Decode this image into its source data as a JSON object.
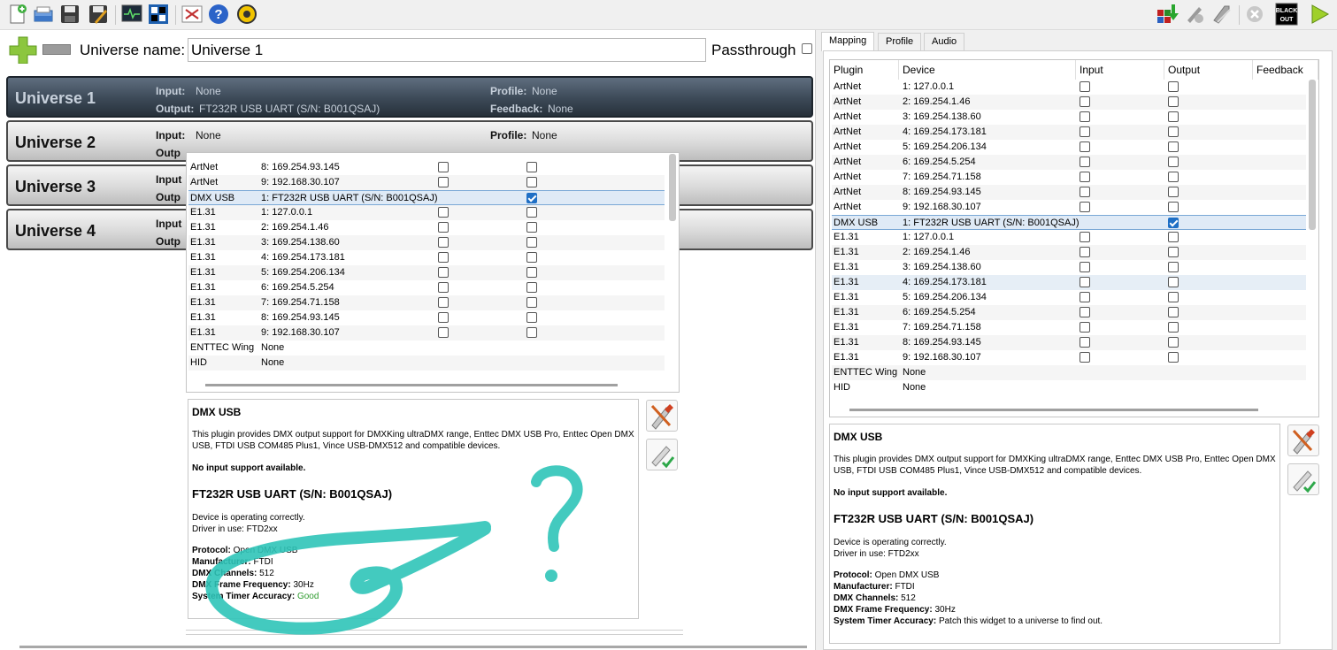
{
  "toolbar": {
    "icons": [
      "new-file-icon",
      "open-file-icon",
      "save-icon",
      "save-as-icon",
      "monitor-icon",
      "fixture-icon",
      "close-icon",
      "help-icon",
      "zoom-icon"
    ],
    "right_icons": [
      "flash-icon",
      "disable-icon",
      "tools-icon",
      "stop-icon",
      "blackout-icon",
      "play-icon"
    ],
    "blackout_label": "BLACK OUT"
  },
  "universe": {
    "name_label": "Universe name:",
    "name_value": "Universe 1",
    "passthrough_label": "Passthrough"
  },
  "universes": [
    {
      "title": "Universe 1",
      "input_label": "Input:",
      "input": "None",
      "output_label": "Output:",
      "output": "FT232R USB UART (S/N: B001QSAJ)",
      "profile_label": "Profile:",
      "profile": "None",
      "feedback_label": "Feedback:",
      "feedback": "None"
    },
    {
      "title": "Universe 2",
      "input_label": "Input:",
      "input": "None",
      "output_label": "Outp",
      "profile_label": "Profile:",
      "profile": "None"
    },
    {
      "title": "Universe 3",
      "input_label": "Input",
      "output_label": "Outp"
    },
    {
      "title": "Universe 4",
      "input_label": "Input",
      "output_label": "Outp"
    }
  ],
  "popup_rows": [
    {
      "plugin": "ArtNet",
      "device": "8: 169.254.93.145",
      "input": false,
      "output": false
    },
    {
      "plugin": "ArtNet",
      "device": "9: 192.168.30.107",
      "input": false,
      "output": false
    },
    {
      "plugin": "DMX USB",
      "device": "1: FT232R USB UART (S/N: B001QSAJ)",
      "output": true,
      "selected": true
    },
    {
      "plugin": "E1.31",
      "device": "1: 127.0.0.1",
      "input": false,
      "output": false
    },
    {
      "plugin": "E1.31",
      "device": "2: 169.254.1.46",
      "input": false,
      "output": false
    },
    {
      "plugin": "E1.31",
      "device": "3: 169.254.138.60",
      "input": false,
      "output": false
    },
    {
      "plugin": "E1.31",
      "device": "4: 169.254.173.181",
      "input": false,
      "output": false
    },
    {
      "plugin": "E1.31",
      "device": "5: 169.254.206.134",
      "input": false,
      "output": false
    },
    {
      "plugin": "E1.31",
      "device": "6: 169.254.5.254",
      "input": false,
      "output": false
    },
    {
      "plugin": "E1.31",
      "device": "7: 169.254.71.158",
      "input": false,
      "output": false
    },
    {
      "plugin": "E1.31",
      "device": "8: 169.254.93.145",
      "input": false,
      "output": false
    },
    {
      "plugin": "E1.31",
      "device": "9: 192.168.30.107",
      "input": false,
      "output": false
    },
    {
      "plugin": "ENTTEC Wing",
      "device": "None"
    },
    {
      "plugin": "HID",
      "device": "None"
    }
  ],
  "plugin_info_left": {
    "title": "DMX USB",
    "desc": "This plugin provides DMX output support for DMXKing ultraDMX range, Enttec DMX USB Pro, Enttec Open DMX USB, FTDI USB COM485 Plus1, Vince USB-DMX512 and compatible devices.",
    "no_input": "No input support available.",
    "device": "FT232R USB UART (S/N: B001QSAJ)",
    "status": "Device is operating correctly.",
    "driver": "Driver in use: FTD2xx",
    "protocol_k": "Protocol:",
    "protocol_v": "Open DMX USB",
    "manufacturer_k": "Manufacturer:",
    "manufacturer_v": "FTDI",
    "channels_k": "DMX Channels:",
    "channels_v": "512",
    "freq_k": "DMX Frame Frequency:",
    "freq_v": "30Hz",
    "timer_k": "System Timer Accuracy:",
    "timer_v": "Good"
  },
  "tabs": [
    "Mapping",
    "Profile",
    "Audio"
  ],
  "right_table": {
    "headers": [
      "Plugin",
      "Device",
      "Input",
      "Output",
      "Feedback"
    ],
    "rows": [
      {
        "plugin": "ArtNet",
        "device": "1: 127.0.0.1",
        "input": false,
        "output": false
      },
      {
        "plugin": "ArtNet",
        "device": "2: 169.254.1.46",
        "input": false,
        "output": false
      },
      {
        "plugin": "ArtNet",
        "device": "3: 169.254.138.60",
        "input": false,
        "output": false
      },
      {
        "plugin": "ArtNet",
        "device": "4: 169.254.173.181",
        "input": false,
        "output": false
      },
      {
        "plugin": "ArtNet",
        "device": "5: 169.254.206.134",
        "input": false,
        "output": false
      },
      {
        "plugin": "ArtNet",
        "device": "6: 169.254.5.254",
        "input": false,
        "output": false
      },
      {
        "plugin": "ArtNet",
        "device": "7: 169.254.71.158",
        "input": false,
        "output": false
      },
      {
        "plugin": "ArtNet",
        "device": "8: 169.254.93.145",
        "input": false,
        "output": false
      },
      {
        "plugin": "ArtNet",
        "device": "9: 192.168.30.107",
        "input": false,
        "output": false
      },
      {
        "plugin": "DMX USB",
        "device": "1: FT232R USB UART (S/N: B001QSAJ)",
        "output": true,
        "selected": true
      },
      {
        "plugin": "E1.31",
        "device": "1: 127.0.0.1",
        "input": false,
        "output": false
      },
      {
        "plugin": "E1.31",
        "device": "2: 169.254.1.46",
        "input": false,
        "output": false
      },
      {
        "plugin": "E1.31",
        "device": "3: 169.254.138.60",
        "input": false,
        "output": false
      },
      {
        "plugin": "E1.31",
        "device": "4: 169.254.173.181",
        "input": false,
        "output": false,
        "hover": true
      },
      {
        "plugin": "E1.31",
        "device": "5: 169.254.206.134",
        "input": false,
        "output": false
      },
      {
        "plugin": "E1.31",
        "device": "6: 169.254.5.254",
        "input": false,
        "output": false
      },
      {
        "plugin": "E1.31",
        "device": "7: 169.254.71.158",
        "input": false,
        "output": false
      },
      {
        "plugin": "E1.31",
        "device": "8: 169.254.93.145",
        "input": false,
        "output": false
      },
      {
        "plugin": "E1.31",
        "device": "9: 192.168.30.107",
        "input": false,
        "output": false
      },
      {
        "plugin": "ENTTEC Wing",
        "device": "None"
      },
      {
        "plugin": "HID",
        "device": "None"
      }
    ]
  },
  "plugin_info_right": {
    "title": "DMX USB",
    "desc": "This plugin provides DMX output support for DMXKing ultraDMX range, Enttec DMX USB Pro, Enttec Open DMX USB, FTDI USB COM485 Plus1, Vince USB-DMX512 and compatible devices.",
    "no_input": "No input support available.",
    "device": "FT232R USB UART (S/N: B001QSAJ)",
    "status": "Device is operating correctly.",
    "driver": "Driver in use: FTD2xx",
    "protocol_k": "Protocol:",
    "protocol_v": "Open DMX USB",
    "manufacturer_k": "Manufacturer:",
    "manufacturer_v": "FTDI",
    "channels_k": "DMX Channels:",
    "channels_v": "512",
    "freq_k": "DMX Frame Frequency:",
    "freq_v": "30Hz",
    "timer_k": "System Timer Accuracy:",
    "timer_v": "Patch this widget to a universe to find out."
  },
  "colors": {
    "annotation": "#2fc4b8",
    "good": "#2e9b2e",
    "selected_row": "#dfeaf6"
  }
}
